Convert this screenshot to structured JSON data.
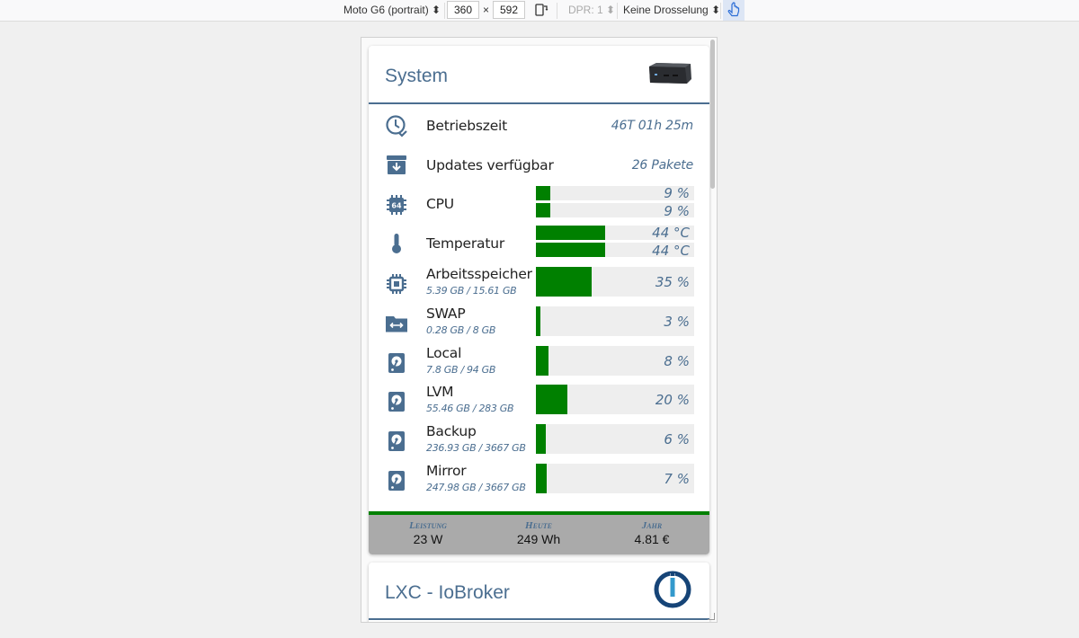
{
  "devtools": {
    "device": "Moto G6 (portrait)",
    "width": "360",
    "times": "×",
    "height": "592",
    "dpr": "DPR: 1",
    "throttling": "Keine Drosselung",
    "rotate_icon": "rotate-icon",
    "touch_icon": "touch-hand-icon"
  },
  "system_card": {
    "title": "System",
    "device_image": "mini-pc-image",
    "rows": [
      {
        "icon": "clock-check-icon",
        "label": "Betriebszeit",
        "value": "46T 01h 25m"
      },
      {
        "icon": "archive-arrow-down-icon",
        "label": "Updates verfügbar",
        "value": "26 Pakete"
      }
    ],
    "cpu": {
      "icon": "cpu-64-icon",
      "label": "CPU",
      "cores": [
        {
          "percent": 9,
          "text": "9 %"
        },
        {
          "percent": 9,
          "text": "9 %"
        }
      ]
    },
    "temperature": {
      "icon": "thermometer-icon",
      "label": "Temperatur",
      "sensors": [
        {
          "level": 0.44,
          "text": "44 °C"
        },
        {
          "level": 0.44,
          "text": "44 °C"
        }
      ]
    },
    "resources": [
      {
        "icon": "memory-chip-icon",
        "label": "Arbeitsspeicher",
        "sub": "5.39 GB / 15.61 GB",
        "percent": 35,
        "text": "35 %"
      },
      {
        "icon": "folder-swap-icon",
        "label": "SWAP",
        "sub": "0.28 GB / 8 GB",
        "percent": 3,
        "text": "3 %"
      },
      {
        "icon": "harddisk-icon",
        "label": "Local",
        "sub": "7.8 GB / 94 GB",
        "percent": 8,
        "text": "8 %"
      },
      {
        "icon": "harddisk-icon",
        "label": "LVM",
        "sub": "55.46 GB / 283 GB",
        "percent": 20,
        "text": "20 %"
      },
      {
        "icon": "harddisk-icon",
        "label": "Backup",
        "sub": "236.93 GB / 3667 GB",
        "percent": 6,
        "text": "6 %"
      },
      {
        "icon": "harddisk-icon",
        "label": "Mirror",
        "sub": "247.98 GB / 3667 GB",
        "percent": 7,
        "text": "7 %"
      }
    ],
    "footer": [
      {
        "label": "Leistung",
        "value": "23 W"
      },
      {
        "label": "Heute",
        "value": "249 Wh"
      },
      {
        "label": "Jahr",
        "value": "4.81 €"
      }
    ]
  },
  "lxc_card": {
    "title": "LXC - IoBroker",
    "logo": "iobroker-logo"
  },
  "colors": {
    "accent": "#4b6e90",
    "bar_fill": "#008000",
    "bar_track": "#eeeeee",
    "footer_bg": "#aaaaaa"
  }
}
